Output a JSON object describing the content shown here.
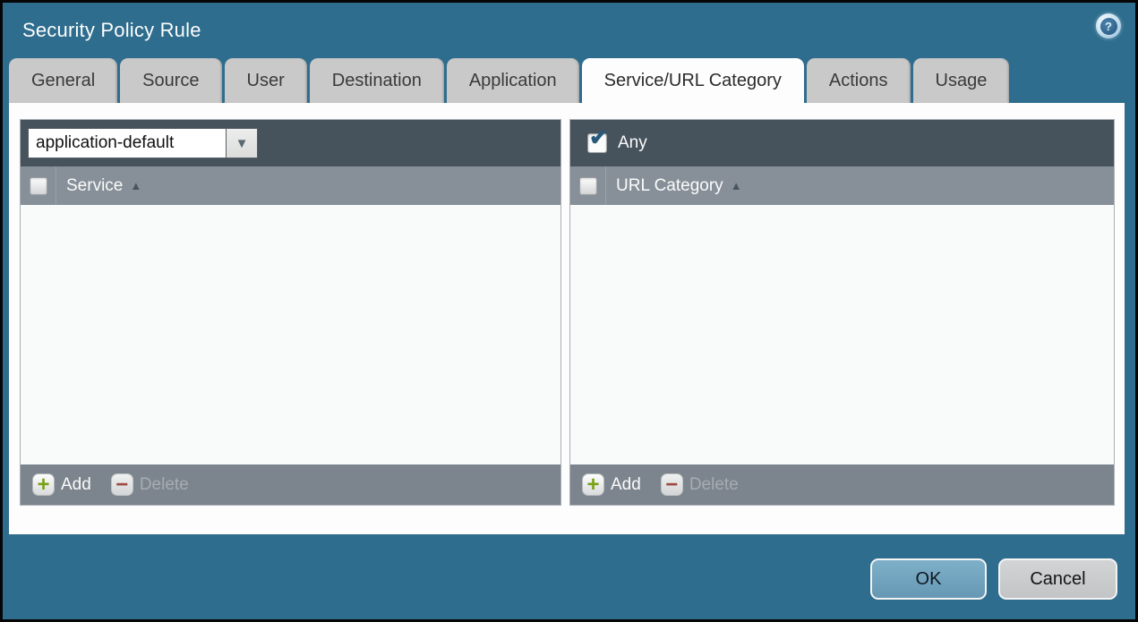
{
  "window": {
    "title": "Security Policy Rule"
  },
  "icons": {
    "help_glyph": "?",
    "dropdown_arrow_glyph": "▼",
    "sort_asc_glyph": "▲",
    "checkmark_glyph": "✔",
    "add_glyph": "+",
    "delete_glyph": "−"
  },
  "tabs": [
    {
      "label": "General",
      "active": false
    },
    {
      "label": "Source",
      "active": false
    },
    {
      "label": "User",
      "active": false
    },
    {
      "label": "Destination",
      "active": false
    },
    {
      "label": "Application",
      "active": false
    },
    {
      "label": "Service/URL Category",
      "active": true
    },
    {
      "label": "Actions",
      "active": false
    },
    {
      "label": "Usage",
      "active": false
    }
  ],
  "service_panel": {
    "dropdown_value": "application-default",
    "column_header": "Service",
    "header_checkbox_checked": false,
    "rows": [],
    "add_label": "Add",
    "delete_label": "Delete",
    "delete_enabled": false
  },
  "url_panel": {
    "any_label": "Any",
    "any_checked": true,
    "column_header": "URL Category",
    "header_checkbox_checked": false,
    "rows": [],
    "add_label": "Add",
    "delete_label": "Delete",
    "delete_enabled": false
  },
  "buttons": {
    "ok_label": "OK",
    "cancel_label": "Cancel"
  },
  "colors": {
    "dialog_teal": "#2e6d8d",
    "outer_border": "#060606",
    "tab_inactive": "#c9c9c9",
    "tab_active": "#fdfdfd",
    "panel_topbar": "#46525c",
    "panel_header": "#879098",
    "panel_footer": "#7c858d",
    "panel_body": "#f9fafa",
    "add_green": "#7ba117",
    "delete_red": "#9e4a41",
    "checkmark_blue": "#27597a",
    "ok_button": "#74a6c0",
    "cancel_button": "#c9cbcc"
  }
}
